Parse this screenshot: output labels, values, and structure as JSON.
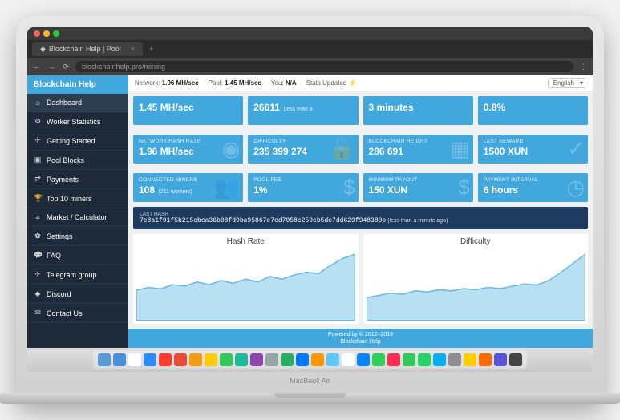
{
  "browser": {
    "tab_title": "Blockchain Help | Pool",
    "url": "blockchainhelp.pro/mining"
  },
  "brand": "Blockchain Help",
  "language": "English",
  "sidebar": {
    "items": [
      {
        "icon": "⌂",
        "label": "Dashboard",
        "active": true
      },
      {
        "icon": "⚙",
        "label": "Worker Statistics"
      },
      {
        "icon": "✈",
        "label": "Getting Started"
      },
      {
        "icon": "▣",
        "label": "Pool Blocks"
      },
      {
        "icon": "⇄",
        "label": "Payments"
      },
      {
        "icon": "🏆",
        "label": "Top 10 miners"
      },
      {
        "icon": "≡",
        "label": "Market / Calculator"
      },
      {
        "icon": "✿",
        "label": "Settings"
      },
      {
        "icon": "💬",
        "label": "FAQ"
      },
      {
        "icon": "✈",
        "label": "Telegram group"
      },
      {
        "icon": "◆",
        "label": "Discord"
      },
      {
        "icon": "✉",
        "label": "Contact Us"
      }
    ]
  },
  "topbar": {
    "network_label": "Network:",
    "network_value": "1.96 MH/sec",
    "pool_label": "Pool:",
    "pool_value": "1.45 MH/sec",
    "you_label": "You:",
    "you_value": "N/A",
    "status": "Stats Updated ⚡"
  },
  "cards_row1": [
    {
      "val": "1.45 MH/sec"
    },
    {
      "val": "26611",
      "sub": "(less than a"
    },
    {
      "val": "3 minutes"
    },
    {
      "val": "0.8%"
    }
  ],
  "cards_row2": [
    {
      "lbl": "NETWORK HASH RATE",
      "val": "1.96 MH/sec",
      "ico": "◉"
    },
    {
      "lbl": "DIFFICULTY",
      "val": "235 399 274",
      "ico": "🔓"
    },
    {
      "lbl": "BLOCKCHAIN HEIGHT",
      "val": "286 691",
      "ico": "▦"
    },
    {
      "lbl": "LAST REWARD",
      "val": "1500 XUN",
      "ico": "✓"
    }
  ],
  "cards_row3": [
    {
      "lbl": "CONNECTED MINERS",
      "val": "108",
      "sub": "(211 workers)",
      "ico": "👥"
    },
    {
      "lbl": "POOL FEE",
      "val": "1%",
      "ico": "$"
    },
    {
      "lbl": "MINIMUM PAYOUT",
      "val": "150 XUN",
      "ico": "$"
    },
    {
      "lbl": "PAYMENT INTERVAL",
      "val": "6 hours",
      "ico": "◷"
    }
  ],
  "lasthash": {
    "label": "LAST HASH",
    "value": "7e8a1f91f5b215ebca36b08fd9ba95867e7cd7058c259cb5dc7dd629f948380e",
    "ago": "(less than a minute ago)"
  },
  "charts": {
    "left": "Hash Rate",
    "right": "Difficulty"
  },
  "footer": {
    "line1": "Powered by © 2012–2019",
    "line2": "Blockchain Help"
  },
  "laptop_model": "MacBook Air",
  "chart_data": [
    {
      "type": "area",
      "title": "Hash Rate",
      "points": [
        22,
        24,
        23,
        26,
        25,
        28,
        26,
        29,
        27,
        30,
        28,
        32,
        30,
        33,
        35,
        34,
        40,
        45,
        48
      ]
    },
    {
      "type": "area",
      "title": "Difficulty",
      "points": [
        20,
        22,
        24,
        23,
        26,
        25,
        27,
        26,
        28,
        27,
        29,
        28,
        30,
        32,
        31,
        35,
        42,
        50,
        58
      ]
    }
  ],
  "dock_colors": [
    "#5b9bd5",
    "#4a90d9",
    "#ffffff",
    "#2d8cff",
    "#ff3b30",
    "#e74c3c",
    "#f39c12",
    "#ffcc00",
    "#34c759",
    "#1abc9c",
    "#8e44ad",
    "#95a5a6",
    "#27ae60",
    "#007aff",
    "#ff9500",
    "#5ac8fa",
    "#ffffff",
    "#0a84ff",
    "#30d158",
    "#ff2d55",
    "#34c759",
    "#25d366",
    "#00aff0",
    "#8e8e93",
    "#ffcc00",
    "#ff6b00",
    "#5856d6",
    "#444"
  ]
}
